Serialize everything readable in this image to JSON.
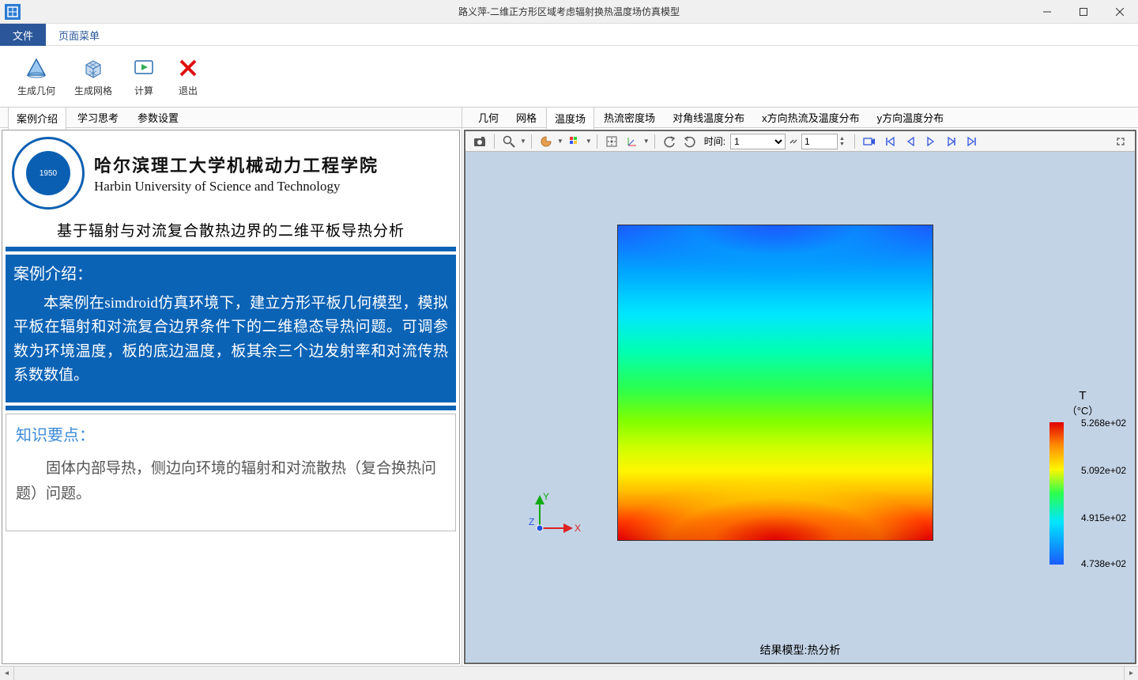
{
  "window": {
    "title": "路义萍-二维正方形区域考虑辐射换热温度场仿真模型"
  },
  "menubar": {
    "tabs": [
      {
        "label": "文件",
        "active": true
      },
      {
        "label": "页面菜单",
        "active": false
      }
    ]
  },
  "ribbon": {
    "buttons": [
      {
        "label": "生成几何",
        "icon": "shape-triangle"
      },
      {
        "label": "生成网格",
        "icon": "shape-cube"
      },
      {
        "label": "计算",
        "icon": "play"
      },
      {
        "label": "退出",
        "icon": "close-x"
      }
    ]
  },
  "left_tabs": [
    {
      "label": "案例介绍",
      "active": true
    },
    {
      "label": "学习思考",
      "active": false
    },
    {
      "label": "参数设置",
      "active": false
    }
  ],
  "university": {
    "cn": "哈尔滨理工大学机械动力工程学院",
    "en": "Harbin University of Science and Technology",
    "year": "1950"
  },
  "subtitle": "基于辐射与对流复合散热边界的二维平板导热分析",
  "intro": {
    "title": "案例介绍：",
    "body": "本案例在simdroid仿真环境下，建立方形平板几何模型，模拟平板在辐射和对流复合边界条件下的二维稳态导热问题。可调参数为环境温度，板的底边温度，板其余三个边发射率和对流传热系数数值。"
  },
  "knowledge": {
    "title": "知识要点：",
    "body": "固体内部导热，侧边向环境的辐射和对流散热（复合换热问题）问题。"
  },
  "viz_tabs": [
    {
      "label": "几何"
    },
    {
      "label": "网格"
    },
    {
      "label": "温度场",
      "active": true
    },
    {
      "label": "热流密度场"
    },
    {
      "label": "对角线温度分布"
    },
    {
      "label": "x方向热流及温度分布"
    },
    {
      "label": "y方向温度分布"
    }
  ],
  "viz_toolbar": {
    "time_label": "时间:",
    "time_value": "1",
    "frame_value": "1"
  },
  "axes": {
    "x": "X",
    "y": "Y",
    "z": "Z"
  },
  "legend": {
    "title": "T",
    "unit": "（°C）",
    "ticks": [
      "5.268e+02",
      "5.092e+02",
      "4.915e+02",
      "4.738e+02"
    ]
  },
  "result_label": "结果模型:热分析",
  "chart_data": {
    "type": "heatmap",
    "title": "温度场 T (°C)",
    "field": "Temperature",
    "domain": "2D square plate",
    "colormap": "rainbow",
    "range_c": [
      473.8,
      526.8
    ],
    "legend_ticks": [
      526.8,
      509.2,
      491.5,
      473.8
    ],
    "gradient_direction": "bottom-hot to top-cold",
    "axes": [
      "X",
      "Y",
      "Z"
    ]
  }
}
